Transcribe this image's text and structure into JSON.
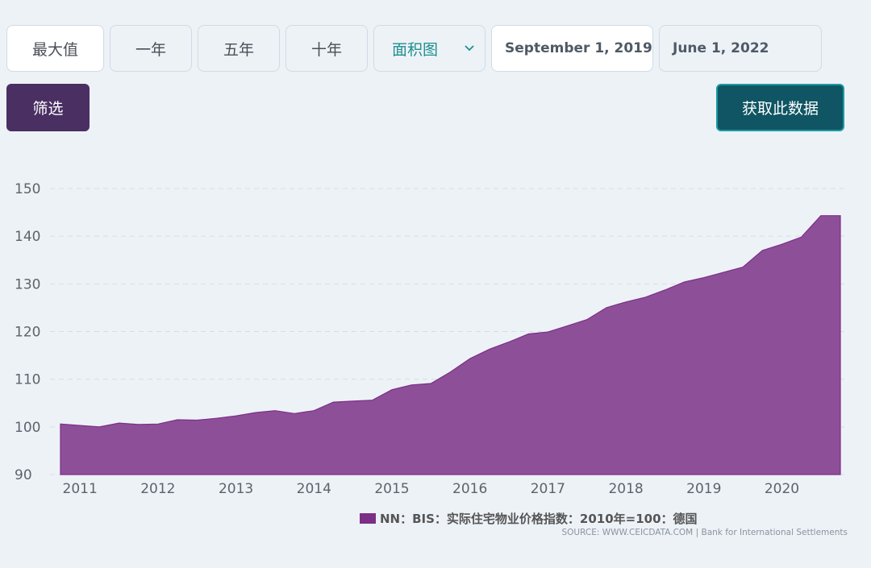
{
  "controls": {
    "range_buttons": [
      "最大值",
      "一年",
      "五年",
      "十年"
    ],
    "chart_type_select": "面积图",
    "start_date": "September 1, 2019",
    "end_date": "June 1, 2022",
    "filter_button": "筛选",
    "get_data_button": "获取此数据"
  },
  "legend_label": "NN：BIS：实际住宅物业价格指数：2010年=100：德国",
  "source_prefix": "SOURCE: WWW.CEICDATA.COM",
  "source_separator": "|",
  "source_org": "Bank for International Settlements",
  "colors": {
    "area_fill": "#8e4f99",
    "area_stroke": "#7b2f86",
    "legend": "#7b2f86"
  },
  "chart_data": {
    "type": "area",
    "y_ticks": [
      90,
      100,
      110,
      120,
      130,
      140,
      150
    ],
    "ylim": [
      90,
      150
    ],
    "x_ticks": [
      "2011",
      "2012",
      "2013",
      "2014",
      "2015",
      "2016",
      "2017",
      "2018",
      "2019",
      "2020"
    ],
    "xlim": [
      2010.75,
      2020.75
    ],
    "grid": "horizontal-dashed",
    "series": [
      {
        "x": [
          2010.75,
          2011.0,
          2011.25,
          2011.5,
          2011.75,
          2012.0,
          2012.25,
          2012.5,
          2012.75,
          2013.0,
          2013.25,
          2013.5,
          2013.75,
          2014.0,
          2014.25,
          2014.5,
          2014.75,
          2015.0,
          2015.25,
          2015.5,
          2015.75,
          2016.0,
          2016.25,
          2016.5,
          2016.75,
          2017.0,
          2017.25,
          2017.5,
          2017.75,
          2018.0,
          2018.25,
          2018.5,
          2018.75,
          2019.0,
          2019.25,
          2019.5,
          2019.75,
          2020.0,
          2020.25,
          2020.5,
          2020.75
        ],
        "values": [
          100.6,
          100.3,
          100.0,
          100.8,
          100.5,
          100.6,
          101.5,
          101.4,
          101.8,
          102.3,
          103.0,
          103.4,
          102.8,
          103.4,
          105.2,
          105.4,
          105.6,
          107.8,
          108.8,
          109.1,
          111.5,
          114.3,
          116.3,
          117.8,
          119.5,
          119.9,
          121.2,
          122.5,
          125.0,
          126.2,
          127.2,
          128.7,
          130.4,
          131.3,
          132.4,
          133.5,
          137.0,
          138.3,
          139.8,
          144.3,
          144.3
        ]
      }
    ]
  }
}
